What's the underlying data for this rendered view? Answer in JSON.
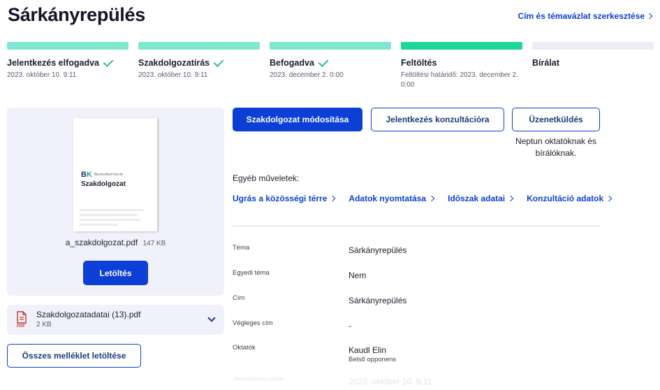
{
  "page": {
    "title": "Sárkányrepülés",
    "edit_link": "Cím és témavázlat szerkesztése"
  },
  "steps": [
    {
      "name": "Jelentkezés elfogadva",
      "meta": "2023. október 10. 9:11",
      "done": true,
      "color": "#7de8cf"
    },
    {
      "name": "Szakdolgozatírás",
      "meta": "2023. október 10. 9:11",
      "done": true,
      "color": "#7de8cf"
    },
    {
      "name": "Befogadva",
      "meta": "2023. december 2. 0:00",
      "done": true,
      "color": "#7de8cf"
    },
    {
      "name": "Feltöltés",
      "meta": "Feltöltési határidő: 2023. december 2. 0:00",
      "done": false,
      "color": "#1ed79b"
    },
    {
      "name": "Bírálat",
      "meta": "",
      "done": false,
      "color": "#ececf6"
    }
  ],
  "document": {
    "thumb_logo": "BK",
    "thumb_org": "Blumenthal Karcid",
    "thumb_title": "Szakdolgozat",
    "filename": "a_szakdolgozat.pdf",
    "size": "147 KB",
    "download_label": "Letöltés"
  },
  "attachment": {
    "type_label": "PDF",
    "filename": "Szakdolgozatadatai (13).pdf",
    "size": "2 KB"
  },
  "all_download_label": "Összes melléklet letöltése",
  "actions": {
    "modify": "Szakdolgozat módosítása",
    "consult": "Jelentkezés konzultációra",
    "message": "Üzenetküldés",
    "message_note": "Neptun oktatóknak és bírálóknak."
  },
  "other": {
    "label": "Egyéb műveletek:",
    "links": [
      "Ugrás a közösségi térre",
      "Adatok nyomtatása",
      "Időszak adatai",
      "Konzultáció adatok"
    ]
  },
  "details": [
    {
      "key": "Téma",
      "value": "Sárkányrepülés"
    },
    {
      "key": "Egyedi téma",
      "value": "Nem"
    },
    {
      "key": "Cím",
      "value": "Sárkányrepülés"
    },
    {
      "key": "Végleges cím",
      "value": "-"
    },
    {
      "key": "Oktatók",
      "value": "Kaudl Elin",
      "sub": "Belső opponens"
    },
    {
      "key": "Jelentkezés ideje",
      "value": "2023. október 10. 9:11"
    }
  ],
  "colors": {
    "accent": "#0b3fd6",
    "panel_bg": "#f0f1fa",
    "check": "#27c28a"
  }
}
